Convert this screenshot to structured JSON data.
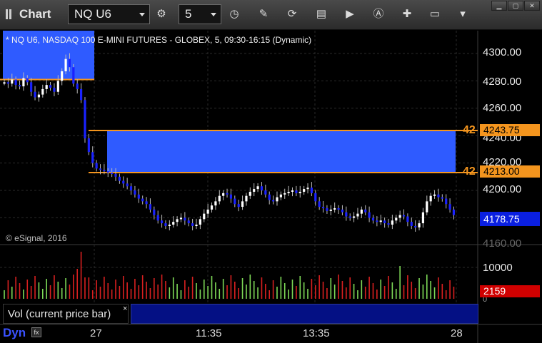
{
  "window": {
    "title": "Chart",
    "symbol": "NQ U6",
    "interval": "5"
  },
  "instrument": {
    "description": "* NQ U6, NASDAQ 100 E-MINI FUTURES - GLOBEX, 5, 09:30-16:15 (Dynamic)"
  },
  "copyright": "© eSignal, 2016",
  "price_axis": {
    "labels": [
      "4300.00",
      "4280.00",
      "4260.00",
      "4240.00",
      "4220.00",
      "4200.00",
      "4180.00",
      "4160.00"
    ]
  },
  "levels": [
    {
      "count": "42",
      "price": "4243.75"
    },
    {
      "count": "42",
      "price": "4213.00"
    }
  ],
  "last_price": "4178.75",
  "volume": {
    "legend": "Vol (current price bar)",
    "close_symbol": "×",
    "axis_label": "10000",
    "zero_label": "0",
    "current": "2159"
  },
  "time_axis": [
    "27",
    "11:35",
    "13:35",
    "28"
  ],
  "footer": {
    "mode": "Dyn",
    "mode_icon": "fx"
  },
  "colors": {
    "up": "#ffffff",
    "down": "#1a22ff",
    "zone": "#2f5bff",
    "level_line": "#f4951e",
    "vol_up": "#7ed957",
    "vol_down": "#d92020"
  },
  "icons": [
    "layout-icon",
    "symbol-dropdown-icon",
    "settings-gear-icon",
    "interval-dropdown-icon",
    "clock-icon",
    "pencil-draw-icon",
    "refresh-icon",
    "get-data-icon",
    "play-icon",
    "alert-icon",
    "tools-icon",
    "comment-icon"
  ]
}
